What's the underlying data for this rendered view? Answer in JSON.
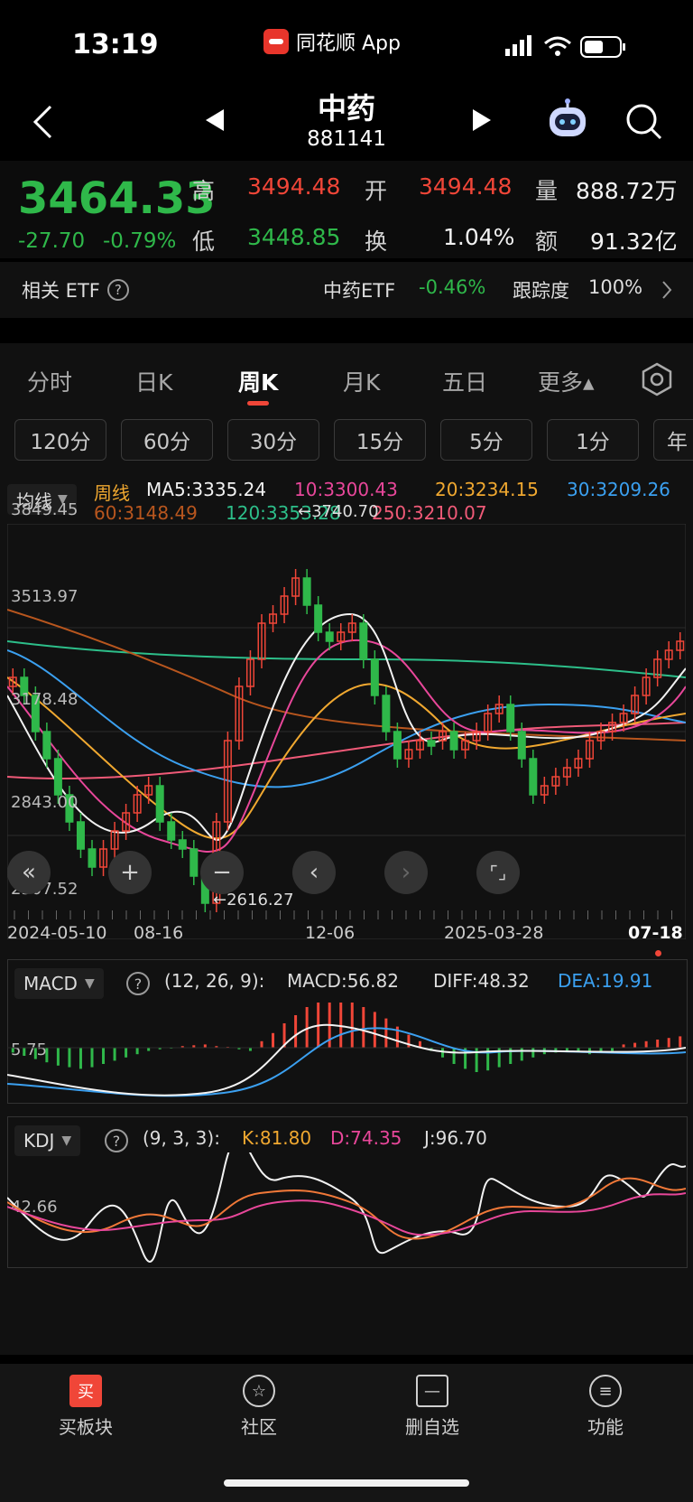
{
  "status": {
    "time": "13:19",
    "app_name": "同花顺 App"
  },
  "header": {
    "title": "中药",
    "code": "881141"
  },
  "quote": {
    "price": "3464.33",
    "change": "-27.70",
    "change_pct": "-0.79%",
    "high_label": "高",
    "high": "3494.48",
    "open_label": "开",
    "open": "3494.48",
    "volume_label": "量",
    "volume": "888.72万",
    "low_label": "低",
    "low": "3448.85",
    "turnover_label": "换",
    "turnover": "1.04%",
    "amount_label": "额",
    "amount": "91.32亿"
  },
  "etf": {
    "label": "相关 ETF",
    "name": "中药ETF",
    "change": "-0.46%",
    "track_label": "跟踪度",
    "track": "100%"
  },
  "tabs": [
    "分时",
    "日K",
    "周K",
    "月K",
    "五日",
    "更多▴"
  ],
  "active_tab": "周K",
  "periods": [
    "120分",
    "60分",
    "30分",
    "15分",
    "5分",
    "1分",
    "年"
  ],
  "ma_legend": {
    "selector": "均线",
    "period": "周线",
    "items": [
      {
        "text": "MA5:3335.24",
        "color": "#f2f2f2"
      },
      {
        "text": "10:3300.43",
        "color": "#e8479a"
      },
      {
        "text": "20:3234.15",
        "color": "#f0a830"
      },
      {
        "text": "30:3209.26",
        "color": "#3ba0f0"
      },
      {
        "text": "60:3148.49",
        "color": "#b8561e"
      },
      {
        "text": "120:3353.28",
        "color": "#2dbf8a"
      },
      {
        "text": "250:3210.07",
        "color": "#f05a78"
      }
    ]
  },
  "price_axis": [
    "3849.45",
    "3513.97",
    "3178.48",
    "2843.00",
    "2507.52"
  ],
  "annotations": {
    "high": "←3740.70",
    "low": "←2616.27"
  },
  "date_axis": [
    "2024-05-10",
    "08-16",
    "12-06",
    "2025-03-28",
    "07-18"
  ],
  "macd": {
    "name": "MACD",
    "params": "(12, 26, 9):",
    "macd": "MACD:56.82",
    "diff": "DIFF:48.32",
    "dea": "DEA:19.91",
    "axis": "5.75"
  },
  "kdj": {
    "name": "KDJ",
    "params": "(9, 3, 3):",
    "k": "K:81.80",
    "d": "D:74.35",
    "j": "J:96.70",
    "axis": "42.66"
  },
  "bottom_nav": [
    {
      "label": "买板块",
      "icon": "买"
    },
    {
      "label": "社区",
      "icon": "☆"
    },
    {
      "label": "删自选",
      "icon": "—"
    },
    {
      "label": "功能",
      "icon": "≡"
    }
  ],
  "colors": {
    "up": "#f04638",
    "down": "#2fb84a",
    "bg": "#111111"
  }
}
